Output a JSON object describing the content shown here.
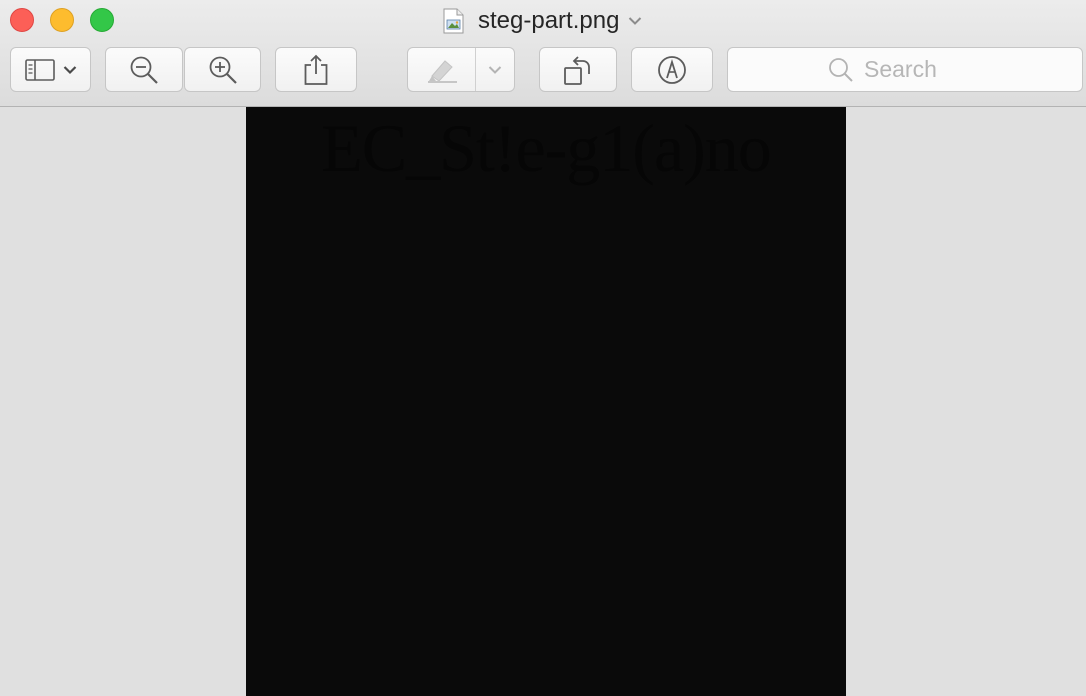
{
  "window": {
    "title": "steg-part.png",
    "title_icon": "png-document-icon",
    "title_menu_icon": "chevron-down-icon"
  },
  "toolbar": {
    "buttons": [
      {
        "name": "sidebar-toggle",
        "icon": "sidebar-icon"
      },
      {
        "name": "zoom-out",
        "icon": "zoom-out-icon"
      },
      {
        "name": "zoom-in",
        "icon": "zoom-in-icon"
      },
      {
        "name": "share",
        "icon": "share-icon"
      },
      {
        "name": "highlight",
        "icon": "highlighter-icon",
        "enabled": false
      },
      {
        "name": "rotate",
        "icon": "rotate-left-icon"
      },
      {
        "name": "markup",
        "icon": "markup-pen-icon"
      }
    ],
    "search_placeholder": "Search"
  },
  "image_content": {
    "text": "EC_St!e-g1(a)no",
    "background_color": "#0a0a0a",
    "text_color": "#060606"
  },
  "colors": {
    "close": "#fc5f57",
    "minimize": "#fdbc2e",
    "maximize": "#33c748",
    "viewer_background": "#e0e0e0"
  }
}
